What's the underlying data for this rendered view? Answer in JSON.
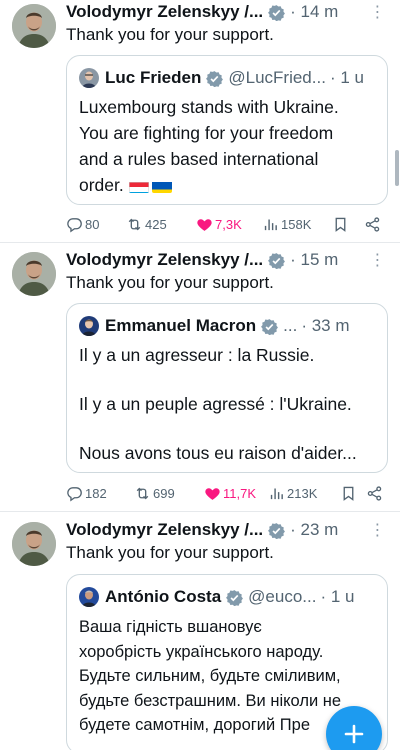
{
  "tweets": [
    {
      "author": "Volodymyr Zelenskyy /...",
      "time": "14 m",
      "text": "Thank you for your support.",
      "quote": {
        "name": "Luc Frieden",
        "handle": "@LucFried...",
        "time": "· 1 u",
        "lines": [
          "Luxembourg stands with Ukraine.",
          "You are fighting for your freedom",
          "and a rules based international",
          "order."
        ]
      },
      "stats": {
        "replies": "80",
        "reposts": "425",
        "likes": "7,3K",
        "views": "158K"
      }
    },
    {
      "author": "Volodymyr Zelenskyy /...",
      "time": "15 m",
      "text": "Thank you for your support.",
      "quote": {
        "name": "Emmanuel Macron",
        "handle": "...",
        "time": "· 33 m",
        "lines": [
          "Il y a un agresseur : la Russie.",
          "Il y a un peuple agressé : l'Ukraine.",
          "Nous avons tous eu raison d'aider..."
        ]
      },
      "stats": {
        "replies": "182",
        "reposts": "699",
        "likes": "11,7K",
        "views": "213K"
      }
    },
    {
      "author": "Volodymyr Zelenskyy /...",
      "time": "23 m",
      "text": "Thank you for your support.",
      "quote": {
        "name": "António Costa",
        "handle": "@euco...",
        "time": "· 1 u",
        "lines": [
          "Ваша гідність вшановує",
          "хоробрість українського народу.",
          "Будьте сильним, будьте сміливим,",
          "будьте безстрашним. Ви ніколи не",
          "будете самотнім, дорогий Пре"
        ]
      }
    }
  ],
  "colors": {
    "accent": "#1d9bf0",
    "like": "#f91880",
    "muted": "#536471"
  },
  "icons": [
    "verified-badge-icon",
    "more-icon",
    "reply-icon",
    "repost-icon",
    "like-icon",
    "views-icon",
    "bookmark-icon",
    "share-icon",
    "compose-icon"
  ]
}
